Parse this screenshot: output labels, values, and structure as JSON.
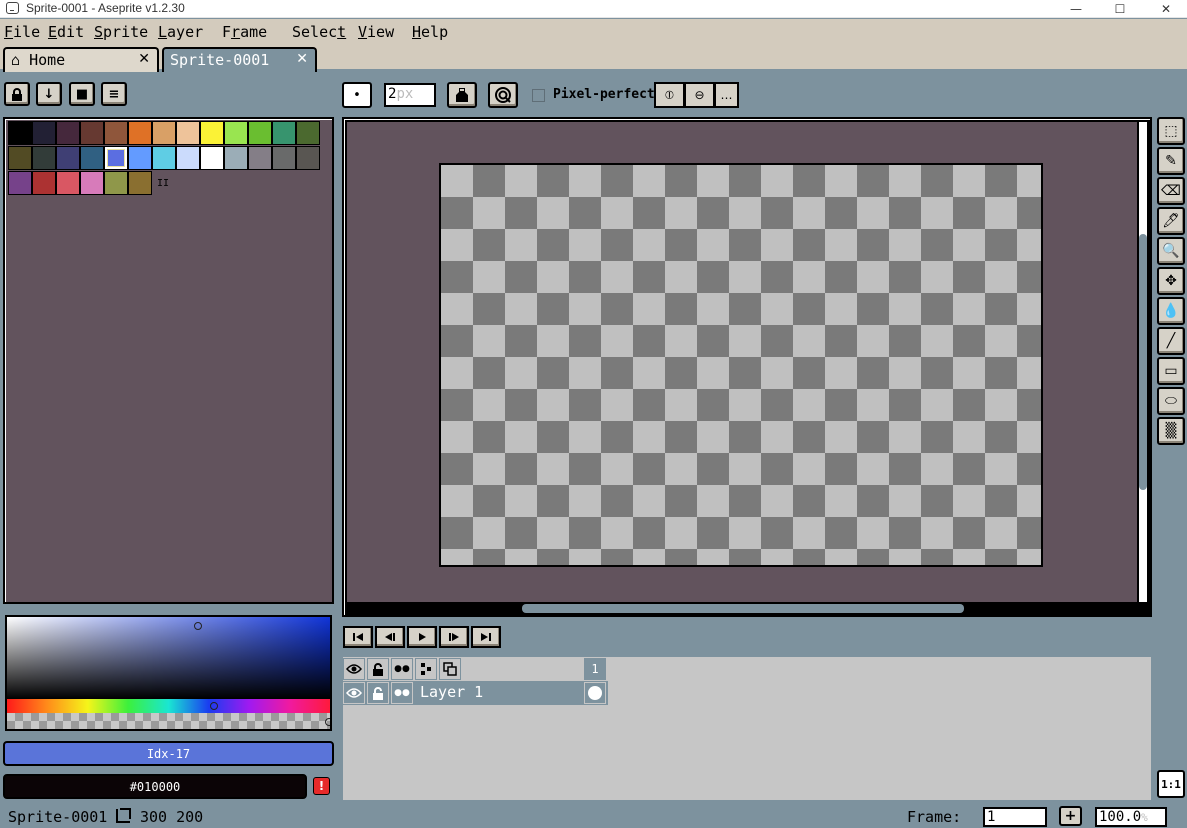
{
  "window": {
    "title": "Sprite-0001 - Aseprite v1.2.30",
    "minimize": "—",
    "maximize": "☐",
    "close": "✕"
  },
  "menu": [
    {
      "label": "File",
      "u": "F",
      "rest": "ile"
    },
    {
      "label": "Edit",
      "u": "E",
      "rest": "dit"
    },
    {
      "label": "Sprite",
      "u": "S",
      "rest": "prite"
    },
    {
      "label": "Layer",
      "u": "L",
      "rest": "ayer"
    },
    {
      "label": "Frame",
      "u": "r",
      "pre": "F",
      "rest": "ame"
    },
    {
      "label": "Select",
      "u": "t",
      "pre": "Selec",
      "rest": ""
    },
    {
      "label": "View",
      "u": "V",
      "rest": "iew"
    },
    {
      "label": "Help",
      "u": "H",
      "rest": "elp"
    }
  ],
  "tabs": {
    "home": {
      "icon": "house-icon",
      "label": "Home",
      "close": "✕"
    },
    "sprite": {
      "label": "Sprite-0001",
      "close": "✕"
    }
  },
  "palette": {
    "buttons": [
      {
        "name": "lock-icon",
        "glyph": "🔒"
      },
      {
        "name": "sort-down-icon",
        "glyph": "↓"
      },
      {
        "name": "palette-stop-icon",
        "glyph": "■"
      },
      {
        "name": "menu-icon",
        "glyph": "≡"
      }
    ],
    "rows": [
      [
        "#000000",
        "#222034",
        "#45283c",
        "#663931",
        "#8f563b",
        "#df7126",
        "#d9a066",
        "#eec39a",
        "#fbf236",
        "#99e550",
        "#6abe30",
        "#37946e",
        "#4b692f"
      ],
      [
        "#524b24",
        "#323c39",
        "#3f3f74",
        "#306082",
        "#5b6ee1",
        "#639bff",
        "#5fcde4",
        "#cbdbfc",
        "#ffffff",
        "#9badb7",
        "#847e87",
        "#696a6a",
        "#595652"
      ],
      [
        "#76428a",
        "#ac3232",
        "#d95763",
        "#d77bba",
        "#8f974a",
        "#8a6f30"
      ]
    ],
    "selected_index": 17,
    "marker": "II"
  },
  "color": {
    "index_label": "Idx-17",
    "hex_label": "#010000",
    "warning": "!",
    "fg_hex": "#5b6ee1"
  },
  "context_bar": {
    "brush_shape": "•",
    "brush_size": "2",
    "brush_unit": "px",
    "ink_icon": "ink-bucket-icon",
    "pixel_perfect_label": "Pixel-perfect",
    "pixel_perfect_checked": false,
    "symmetry": [
      "⦶",
      "⊖",
      "…"
    ]
  },
  "tools": [
    {
      "name": "rectangular-marquee-icon",
      "glyph": "⬚"
    },
    {
      "name": "pencil-icon",
      "glyph": "✎"
    },
    {
      "name": "eraser-icon",
      "glyph": "⌫"
    },
    {
      "name": "eyedropper-icon",
      "glyph": "🖊"
    },
    {
      "name": "zoom-icon",
      "glyph": "🔍"
    },
    {
      "name": "move-icon",
      "glyph": "✥"
    },
    {
      "name": "paint-bucket-icon",
      "glyph": "💧"
    },
    {
      "name": "line-icon",
      "glyph": "╱"
    },
    {
      "name": "rectangle-icon",
      "glyph": "▭"
    },
    {
      "name": "contour-icon",
      "glyph": "⬭"
    },
    {
      "name": "blur-icon",
      "glyph": "▒"
    }
  ],
  "ratio_button": "1:1",
  "animation": [
    {
      "name": "first-frame-icon",
      "glyph": "⏮"
    },
    {
      "name": "prev-frame-icon",
      "glyph": "◀"
    },
    {
      "name": "play-icon",
      "glyph": "▶"
    },
    {
      "name": "next-frame-icon",
      "glyph": "▶"
    },
    {
      "name": "last-frame-icon",
      "glyph": "⏭"
    }
  ],
  "timeline": {
    "header_icons": [
      {
        "name": "visibility-icon",
        "glyph": "👁"
      },
      {
        "name": "lock-icon",
        "glyph": "🔓"
      },
      {
        "name": "continuous-icon",
        "glyph": "●●"
      },
      {
        "name": "layer-tree-icon",
        "glyph": "⊶"
      },
      {
        "name": "onion-skin-icon",
        "glyph": "⧉"
      }
    ],
    "frame_number": "1",
    "layer": {
      "name": "Layer 1",
      "icons": [
        {
          "name": "visibility-icon",
          "glyph": "👁"
        },
        {
          "name": "lock-icon",
          "glyph": "🔓"
        },
        {
          "name": "continuous-icon",
          "glyph": "●●"
        }
      ]
    }
  },
  "status": {
    "sprite_name": "Sprite-0001",
    "size": "300 200",
    "frame_label": "Frame:",
    "frame_value": "1",
    "add_frame": "+",
    "zoom": "100.0",
    "zoom_unit": "%"
  }
}
